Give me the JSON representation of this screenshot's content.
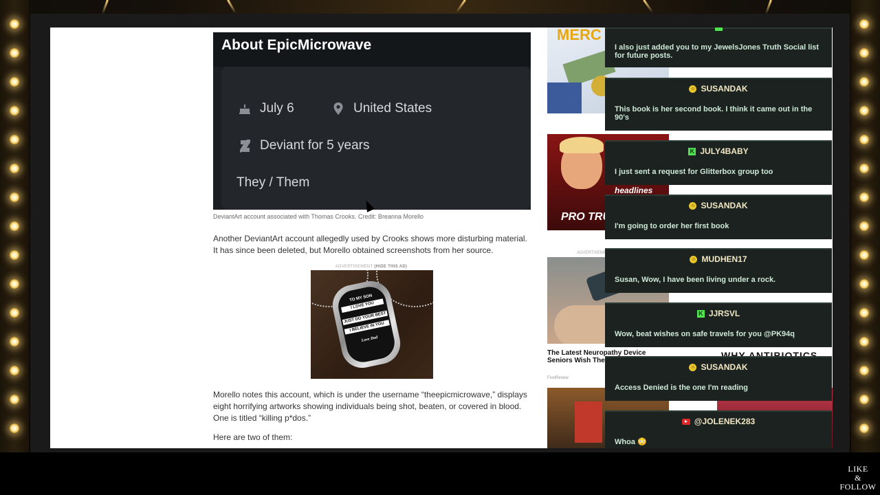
{
  "article": {
    "card_title": "About EpicMicrowave",
    "birthday": "July 6",
    "location": "United States",
    "deviant_since": "Deviant for 5 years",
    "pronouns": "They / Them",
    "caption": "DeviantArt account associated with Thomas Crooks. Credit: Breanna Morello",
    "paragraph1": "Another DeviantArt account allegedly used by Crooks shows more disturbing material. It has since been deleted, but Morello obtained screenshots from her source.",
    "ad_label": "ADVERTISEMENT",
    "ad_hide": "(HIDE THIS AD)",
    "dogtag_lines": [
      "TO MY SON",
      "I LOVE YOU",
      "JUST DO YOUR BEST",
      "I BELIEVE IN YOU",
      "Love Dad"
    ],
    "paragraph2": "Morello notes this account, which is under the username “theepicmicrowave,” displays eight horrifying artworks showing individuals being shot, beaten, or covered in blood. One is titled “killing p*dos.”",
    "paragraph3": "Here are two of them:"
  },
  "sidebar": {
    "ad1_text": "MERC",
    "ad2_banner": "headlines",
    "ad2_text": "PRO TRU",
    "ad_label": "ADVERTISEMENT",
    "neuropathy_title": "The Latest Neuropathy Device Seniors Wish They Knew Sooner",
    "neuropathy_source": "FootRenew",
    "antibiotics_text": "WHY ANTIBIOTICS"
  },
  "chat": [
    {
      "platform": "kick",
      "user": "",
      "message": "I also just added you to my JewelsJones Truth Social list for future posts."
    },
    {
      "platform": "rumble",
      "user": "SUSANDAK",
      "message": "This book is her second book. I think it came out in the 90's"
    },
    {
      "platform": "kick",
      "user": "JULY4BABY",
      "message": "I just sent a request for Glitterbox group too"
    },
    {
      "platform": "rumble",
      "user": "SUSANDAK",
      "message": "I'm going to order her first book"
    },
    {
      "platform": "rumble",
      "user": "MUDHEN17",
      "message": "Susan, Wow, I have been living under a rock."
    },
    {
      "platform": "kick",
      "user": "JJRSVL",
      "message": "Wow, beat wishes on safe travels for you @PK94q"
    },
    {
      "platform": "rumble",
      "user": "SUSANDAK",
      "message": "Access Denied is the one I'm reading"
    },
    {
      "platform": "youtube",
      "user": "@JOLENEK283",
      "message": "Whoa 😳"
    }
  ],
  "overlay": {
    "like": "LIKE",
    "amp": "&",
    "follow": "FOLLOW"
  },
  "colors": {
    "page_bg": "#ffffff",
    "chat_bg": "#1b2220",
    "chat_name": "#f2e7c4",
    "chat_msg": "#cfe9d9",
    "kick_green": "#52e252",
    "rumble_yellow": "#e7c52c"
  }
}
